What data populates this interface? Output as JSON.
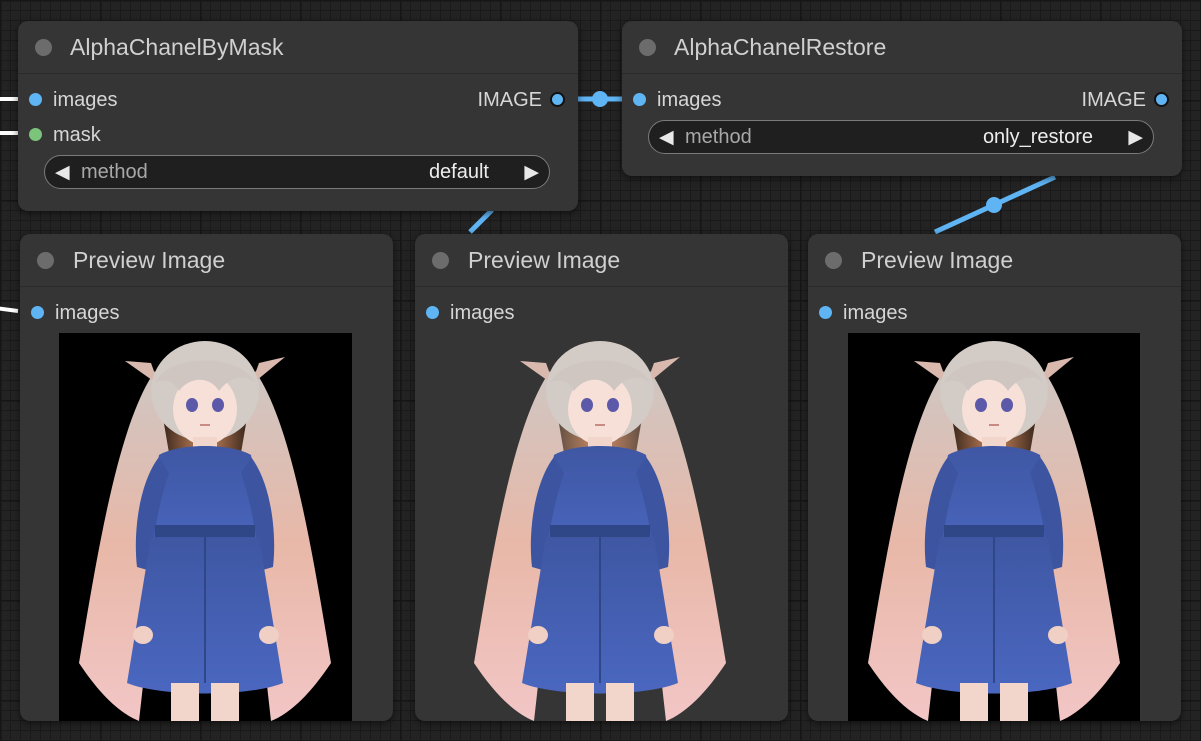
{
  "colors": {
    "canvas": "#232323",
    "node_body": "#353535",
    "link_image": "#5fb4f4",
    "link_mask": "#ffffff",
    "slot_image": "#5fb4f4",
    "slot_mask": "#7cc47c"
  },
  "nodes": {
    "alpha_by_mask": {
      "title": "AlphaChanelByMask",
      "inputs": [
        "images",
        "mask"
      ],
      "output": "IMAGE",
      "widget": {
        "label": "method",
        "value": "default"
      }
    },
    "alpha_restore": {
      "title": "AlphaChanelRestore",
      "inputs": [
        "images"
      ],
      "output": "IMAGE",
      "widget": {
        "label": "method",
        "value": "only_restore"
      }
    },
    "preview_1": {
      "title": "Preview Image",
      "input": "images",
      "background": "black"
    },
    "preview_2": {
      "title": "Preview Image",
      "input": "images",
      "background": "transparent"
    },
    "preview_3": {
      "title": "Preview Image",
      "input": "images",
      "background": "black"
    }
  },
  "icons": {
    "arrow_left": "◀",
    "arrow_right": "▶",
    "node_status": "circle-dot-icon"
  }
}
